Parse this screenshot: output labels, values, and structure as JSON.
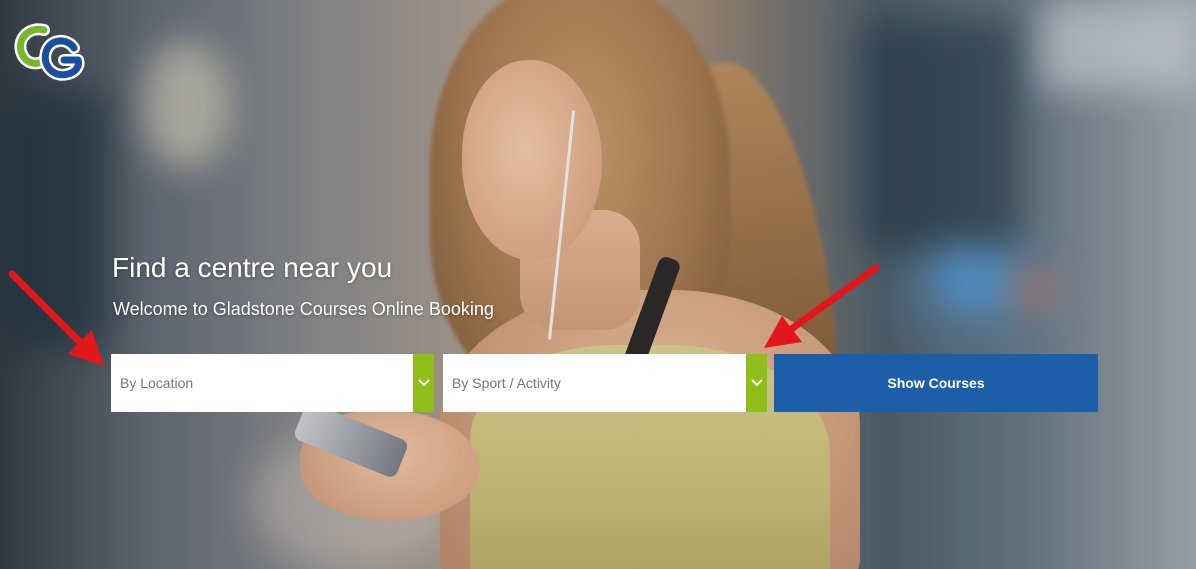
{
  "hero": {
    "title": "Find a centre near you",
    "subtitle": "Welcome to Gladstone Courses Online Booking"
  },
  "search": {
    "location_placeholder": "By Location",
    "sport_placeholder": "By Sport / Activity",
    "submit_label": "Show Courses"
  },
  "icons": {
    "logo": "gladstone-cg-logo",
    "dropdown": "chevron-down-icon",
    "annotation": "red-arrow"
  },
  "colors": {
    "dropdown_accent": "#8fbd1a",
    "button_bg": "#1d5ea8",
    "annotation_red": "#e3161b",
    "logo_green": "#76b82a",
    "logo_blue": "#1a4fa0"
  }
}
